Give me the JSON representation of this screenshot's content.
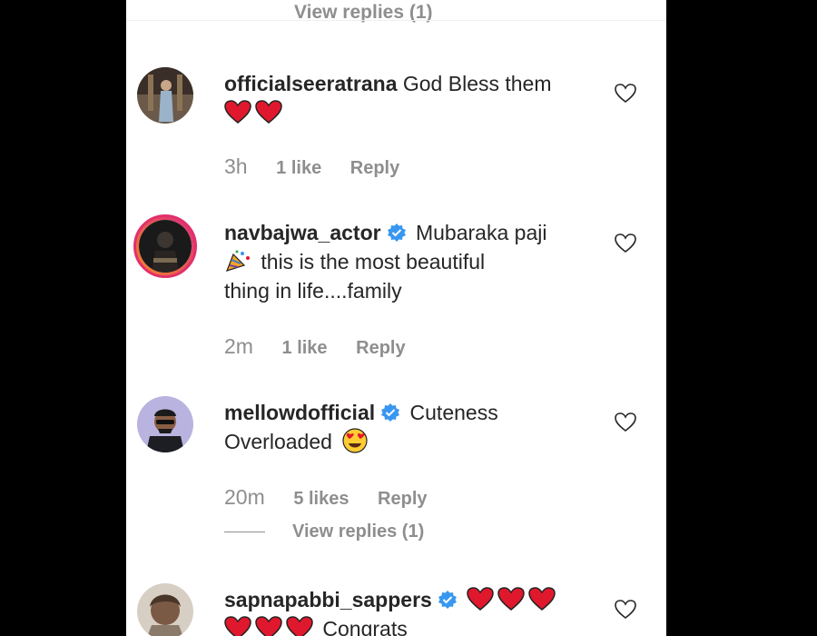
{
  "top_cut": {
    "label": "View replies (1)"
  },
  "comments": [
    {
      "username": "officialseeratrana",
      "verified": false,
      "text": "God Bless them",
      "time": "3h",
      "likes": "1 like",
      "reply": "Reply"
    },
    {
      "username": "navbajwa_actor",
      "verified": true,
      "text_line1": "Mubaraka paji",
      "text_line2": "this is the most beautiful",
      "text_line3": "thing in life....family",
      "time": "2m",
      "likes": "1 like",
      "reply": "Reply"
    },
    {
      "username": "mellowdofficial",
      "verified": true,
      "text_line1": "Cuteness",
      "text_line2": "Overloaded",
      "time": "20m",
      "likes": "5 likes",
      "reply": "Reply",
      "view_replies": "View replies (1)"
    },
    {
      "username": "sapnapabbi_sappers",
      "verified": true,
      "text_line2": "Congrats"
    }
  ],
  "colors": {
    "username": "#262626",
    "meta": "#8e8e8e",
    "verified": "#3897f0",
    "heart": "#e0182d",
    "background_outer": "#000000"
  },
  "icons": {
    "like": "heart-outline-icon",
    "verified": "verified-badge-icon",
    "emoji_heart": "red-heart-emoji",
    "emoji_party": "party-popper-emoji",
    "emoji_heart_eyes": "heart-eyes-emoji"
  }
}
